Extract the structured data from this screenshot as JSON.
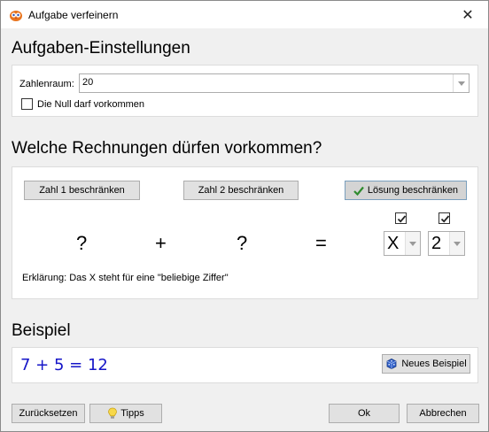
{
  "window": {
    "title": "Aufgabe verfeinern",
    "close_glyph": "✕"
  },
  "settings": {
    "heading": "Aufgaben-Einstellungen",
    "range_label": "Zahlenraum:",
    "range_value": "20",
    "zero_checkbox_label": "Die Null darf vorkommen",
    "zero_checkbox_checked": false
  },
  "calc": {
    "heading": "Welche Rechnungen dürfen vorkommen?",
    "limit1_label": "Zahl 1 beschränken",
    "limit2_label": "Zahl 2 beschränken",
    "limit_result_label": "Lösung beschränken",
    "limit_result_active": true,
    "operand1": "?",
    "operator": "+",
    "operand2": "?",
    "equals": "=",
    "digit1_checked": true,
    "digit1_value": "X",
    "digit2_checked": true,
    "digit2_value": "2",
    "explanation": "Erklärung: Das X steht für eine \"beliebige Ziffer\""
  },
  "example": {
    "heading": "Beispiel",
    "text": "7 + 5 = 12",
    "new_example_label": "Neues Beispiel"
  },
  "footer": {
    "reset_label": "Zurücksetzen",
    "tips_label": "Tipps",
    "ok_label": "Ok",
    "cancel_label": "Abbrechen"
  },
  "colors": {
    "example_text": "#1515c8",
    "check_green": "#2e8b2e"
  },
  "icons": {
    "app": "app-owl-icon",
    "check": "green-check-icon",
    "dice": "dice-icon",
    "bulb": "lightbulb-icon"
  }
}
